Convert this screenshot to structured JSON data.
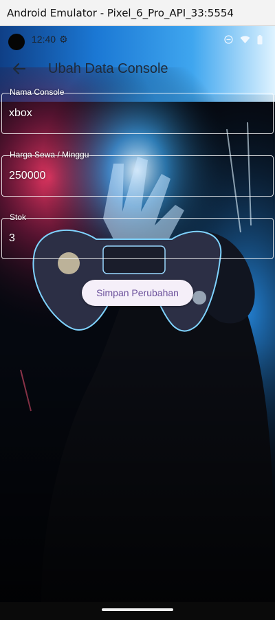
{
  "window": {
    "title": "Android Emulator - Pixel_6_Pro_API_33:5554"
  },
  "status_bar": {
    "time": "12:40",
    "icons": [
      "camera-cutout",
      "settings-icon",
      "dnd-icon",
      "wifi-icon",
      "battery-icon"
    ]
  },
  "app_bar": {
    "title": "Ubah Data Console",
    "back_icon": "arrow-left-icon"
  },
  "form": {
    "fields": [
      {
        "label": "Nama Console",
        "value": "xbox"
      },
      {
        "label": "Harga Sewa / Minggu",
        "value": "250000"
      },
      {
        "label": "Stok",
        "value": "3"
      }
    ],
    "submit_label": "Simpan Perubahan"
  },
  "background": {
    "description_icon": "gamepad-wallpaper",
    "accent_blue": "#1c8fe0",
    "accent_red": "#d8345a"
  },
  "colors": {
    "button_bg": "#f5eff9",
    "button_text": "#6a4f9a",
    "field_border": "#ffffff"
  }
}
